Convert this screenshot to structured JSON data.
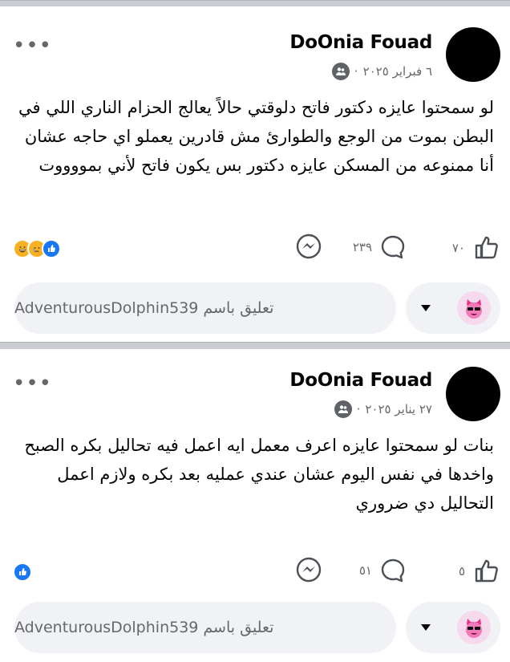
{
  "posts": [
    {
      "author": "DoOnia Fouad",
      "date": "٦ فبراير ٢٠٢٥",
      "separator": "·",
      "body": "لو سمحتوا عايزه دكتور فاتح دلوقتي حالاً يعالج الحزام الناري اللي في البطن بموت من الوجع والطوارئ مش قادرين يعملو اي حاجه عشان أنا ممنوعه من المسكن عايزه دكتور بس يكون فاتح لأني بمووووت",
      "like_count": "٧٠",
      "comment_count": "٢٣٩",
      "reactions": [
        "laugh-reaction",
        "sad-reaction",
        "like-reaction"
      ],
      "comment_placeholder": "تعليق باسم AdventurousDolphin539"
    },
    {
      "author": "DoOnia Fouad",
      "date": "٢٧ يناير ٢٠٢٥",
      "separator": "·",
      "body": "بنات لو سمحتوا عايزه اعرف معمل ايه اعمل فيه تحاليل بكره الصبح واخدها في نفس اليوم عشان عندي عمليه بعد بكره ولازم اعمل التحاليل دي ضروري",
      "like_count": "٥",
      "comment_count": "٥١",
      "reactions": [
        "like-reaction"
      ],
      "comment_placeholder": "تعليق باسم AdventurousDolphin539"
    }
  ],
  "colors": {
    "like_blue": "#1877f2",
    "laugh_yellow": "#f7b125",
    "sad_yellow": "#f7b125",
    "divider": "#c9ccd1",
    "comment_bg": "#f0f2f5"
  },
  "icons": {
    "more": "more-options-icon",
    "privacy": "friends-privacy-icon",
    "like": "like-icon",
    "comment": "comment-icon",
    "share": "messenger-share-icon",
    "dropdown": "caret-down-icon"
  }
}
